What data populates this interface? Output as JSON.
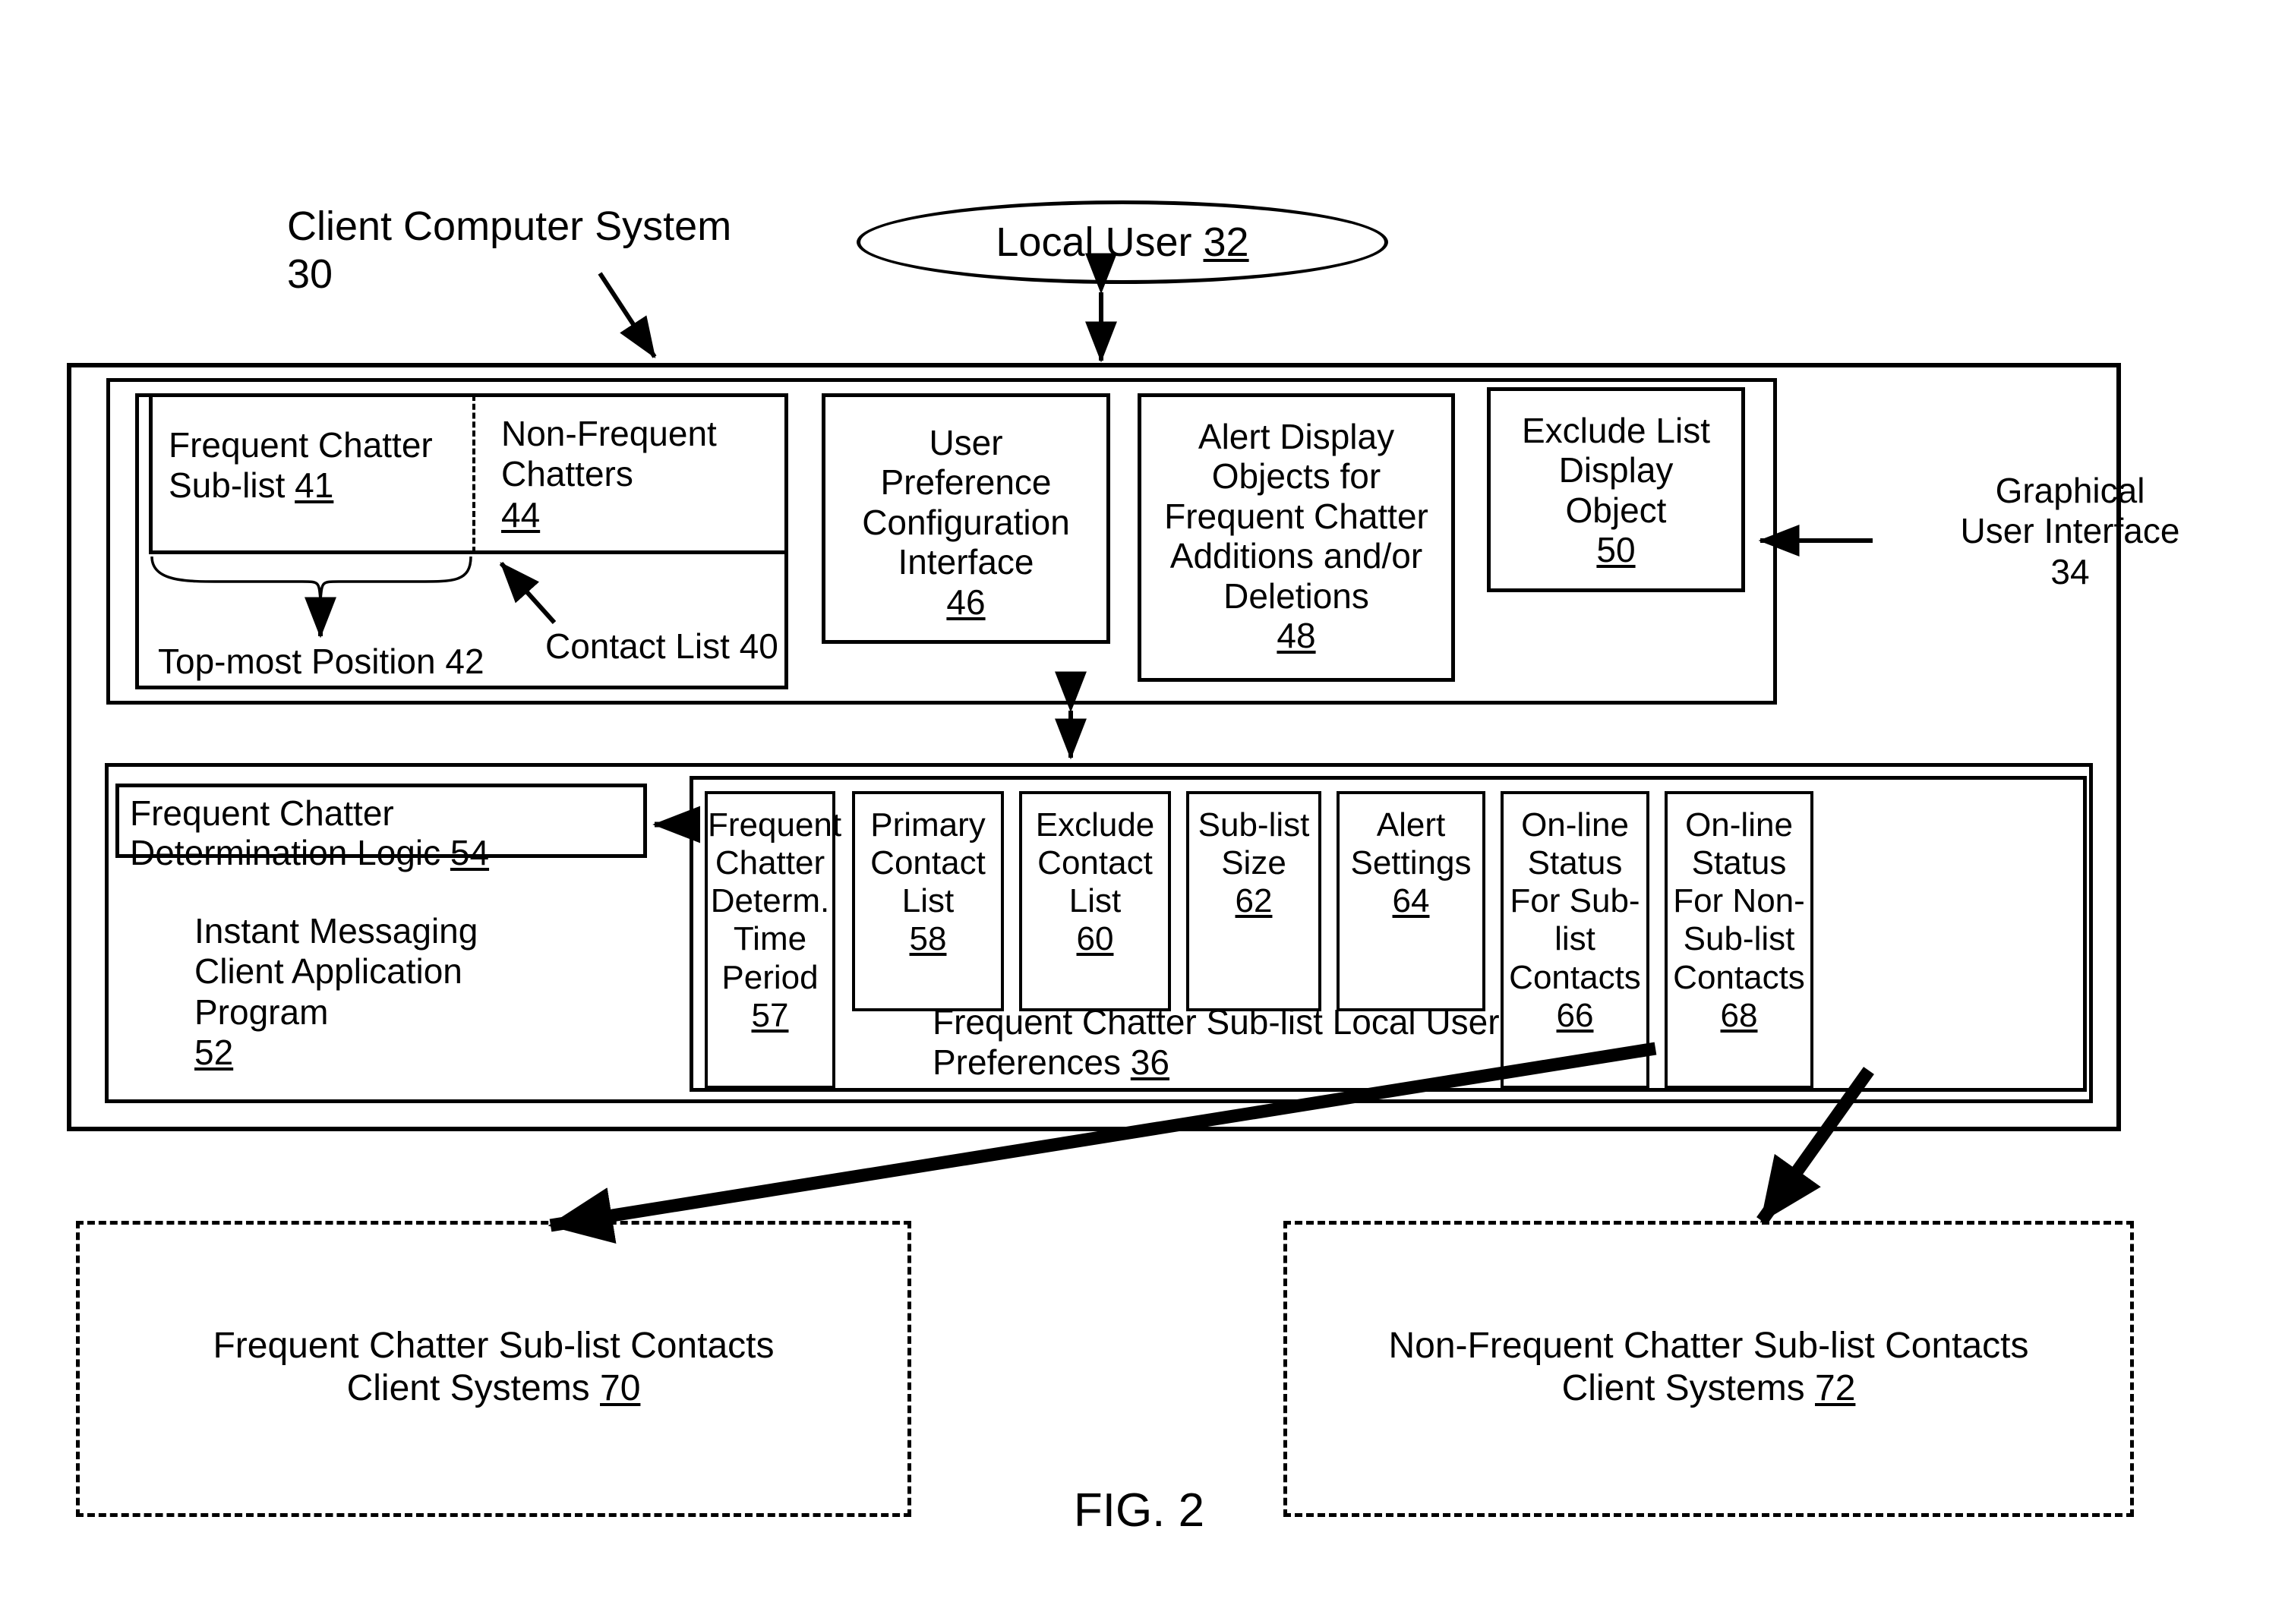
{
  "figure": {
    "caption": "FIG. 2"
  },
  "labels": {
    "client_computer_system": "Client Computer System 30",
    "contact_list": "Contact List 40",
    "top_most_position": "Top-most Position 42",
    "graphical_user_interface_line1": "Graphical",
    "graphical_user_interface_line2": "User Interface",
    "graphical_user_interface_line3": "34",
    "preferences_line1": "Frequent Chatter Sub-list Local User",
    "preferences_line2_text": "Preferences ",
    "preferences_line2_num": "36"
  },
  "actor": {
    "local_user_text": "Local User ",
    "local_user_num": "32"
  },
  "gui": {
    "contact_list": {
      "frequent_sub_list_line1": "Frequent Chatter",
      "frequent_sub_list_line2_text": "Sub-list ",
      "frequent_sub_list_line2_num": "41",
      "non_frequent_line1": "Non-Frequent",
      "non_frequent_line2": "Chatters",
      "non_frequent_num": "44"
    },
    "user_preference_config": {
      "line1": "User",
      "line2": "Preference",
      "line3": "Configuration",
      "line4": "Interface",
      "num": "46"
    },
    "alert_display_objects": {
      "line1": "Alert Display",
      "line2": "Objects for",
      "line3": "Frequent Chatter",
      "line4": "Additions and/or",
      "line5": "Deletions",
      "num": "48"
    },
    "exclude_list_display_object": {
      "line1": "Exclude List",
      "line2": "Display",
      "line3": "Object",
      "num": "50"
    }
  },
  "im_client": {
    "determination_logic": {
      "line1": "Frequent Chatter",
      "line2_text": "Determination Logic ",
      "line2_num": "54"
    },
    "program": {
      "line1": "Instant Messaging",
      "line2": "Client Application",
      "line3": "Program",
      "num": "52"
    },
    "preference_items": [
      {
        "id": "frequent-chatter-determ-time-period",
        "lines": [
          "Frequent",
          "Chatter",
          "Determ.",
          "Time",
          "Period"
        ],
        "num": "57"
      },
      {
        "id": "primary-contact-list",
        "lines": [
          "Primary",
          "Contact",
          "List"
        ],
        "num": "58"
      },
      {
        "id": "exclude-contact-list",
        "lines": [
          "Exclude",
          "Contact",
          "List"
        ],
        "num": "60"
      },
      {
        "id": "sub-list-size",
        "lines": [
          "Sub-list",
          "Size"
        ],
        "num": "62"
      },
      {
        "id": "alert-settings",
        "lines": [
          "Alert",
          "Settings"
        ],
        "num": "64"
      },
      {
        "id": "online-status-sub-list-contacts",
        "lines": [
          "On-line",
          "Status",
          "For Sub-",
          "list",
          "Contacts"
        ],
        "num": "66"
      },
      {
        "id": "online-status-non-sub-list-contacts",
        "lines": [
          "On-line",
          "Status",
          "For Non-",
          "Sub-list",
          "Contacts"
        ],
        "num": "68"
      }
    ]
  },
  "external_systems": {
    "frequent": {
      "line1": "Frequent Chatter Sub-list Contacts",
      "line2_text": "Client Systems ",
      "line2_num": "70"
    },
    "non_frequent": {
      "line1": "Non-Frequent Chatter Sub-list Contacts",
      "line2_text": "Client Systems ",
      "line2_num": "72"
    }
  },
  "colors": {
    "stroke": "#000000",
    "background": "#ffffff"
  }
}
